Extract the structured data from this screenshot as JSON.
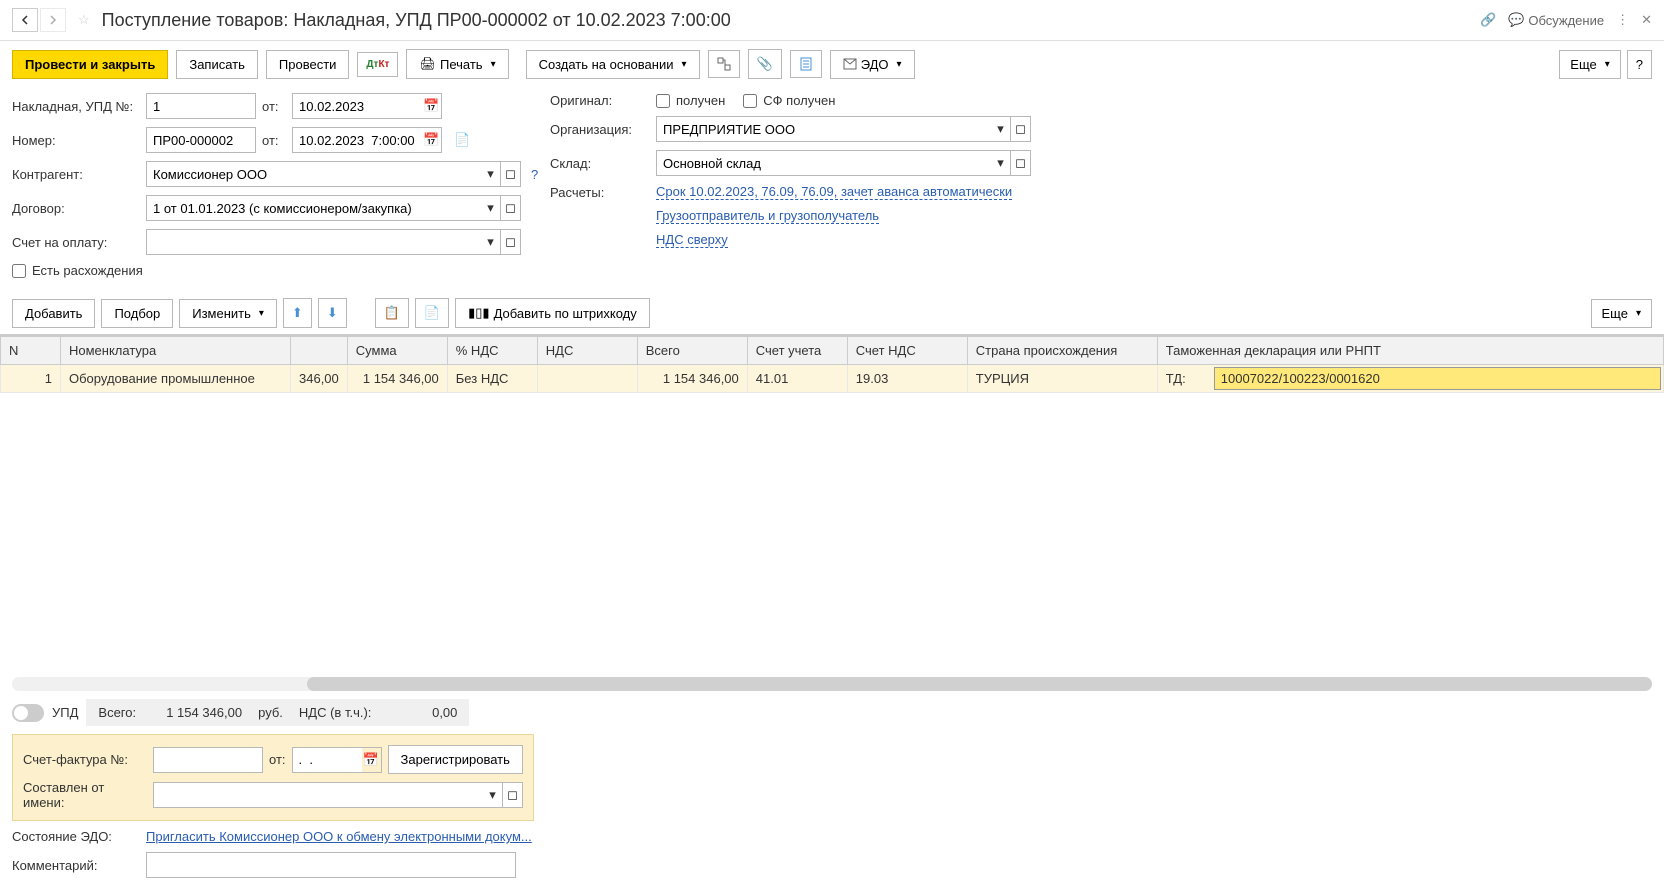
{
  "header": {
    "title": "Поступление товаров: Накладная, УПД ПР00-000002 от 10.02.2023 7:00:00",
    "discussion": "Обсуждение"
  },
  "toolbar": {
    "post_close": "Провести и закрыть",
    "save": "Записать",
    "post": "Провести",
    "print": "Печать",
    "create_based": "Создать на основании",
    "edo": "ЭДО",
    "more": "Еще",
    "help": "?"
  },
  "form": {
    "invoice_upd_label": "Накладная, УПД №:",
    "invoice_num": "1",
    "from_label": "от:",
    "invoice_date": "10.02.2023",
    "number_label": "Номер:",
    "number": "ПР00-000002",
    "number_date": "10.02.2023  7:00:00",
    "counterparty_label": "Контрагент:",
    "counterparty": "Комиссионер ООО",
    "contract_label": "Договор:",
    "contract": "1 от 01.01.2023 (с комиссионером/закупка)",
    "payment_invoice_label": "Счет на оплату:",
    "payment_invoice": "",
    "discrepancies_label": "Есть расхождения",
    "original_label": "Оригинал:",
    "received_label": "получен",
    "sf_received_label": "СФ получен",
    "organization_label": "Организация:",
    "organization": "ПРЕДПРИЯТИЕ ООО",
    "warehouse_label": "Склад:",
    "warehouse": "Основной склад",
    "settlements_label": "Расчеты:",
    "settlements_link": "Срок 10.02.2023, 76.09, 76.09, зачет аванса автоматически",
    "shipper_link": "Грузоотправитель и грузополучатель",
    "vat_link": "НДС сверху"
  },
  "table_toolbar": {
    "add": "Добавить",
    "select": "Подбор",
    "change": "Изменить",
    "barcode": "Добавить по штрихкоду",
    "more": "Еще"
  },
  "table": {
    "headers": {
      "n": "N",
      "nomenclature": "Номенклатура",
      "qty": "",
      "sum": "Сумма",
      "vat_pct": "% НДС",
      "vat": "НДС",
      "total": "Всего",
      "account": "Счет учета",
      "vat_account": "Счет НДС",
      "country": "Страна происхождения",
      "customs": "Таможенная декларация или РНПТ"
    },
    "rows": [
      {
        "n": "1",
        "nomenclature": "Оборудование промышленное",
        "qty": "346,00",
        "sum": "1 154 346,00",
        "vat_pct": "Без НДС",
        "vat": "",
        "total": "1 154 346,00",
        "account": "41.01",
        "vat_account": "19.03",
        "country": "ТУРЦИЯ",
        "customs_prefix": "ТД:",
        "customs": "10007022/100223/0001620"
      }
    ]
  },
  "footer": {
    "upd_label": "УПД",
    "totals_label": "Всего:",
    "totals_sum": "1 154 346,00",
    "currency": "руб.",
    "vat_incl_label": "НДС (в т.ч.):",
    "vat_incl": "0,00",
    "invoice_sf_label": "Счет-фактура №:",
    "invoice_sf_from": "от:",
    "invoice_sf_date": ".  .",
    "register": "Зарегистрировать",
    "issued_by_label": "Составлен от имени:",
    "edo_state_label": "Состояние ЭДО:",
    "edo_state_link": "Пригласить Комиссионер ООО к обмену электронными докум...",
    "comment_label": "Комментарий:"
  }
}
